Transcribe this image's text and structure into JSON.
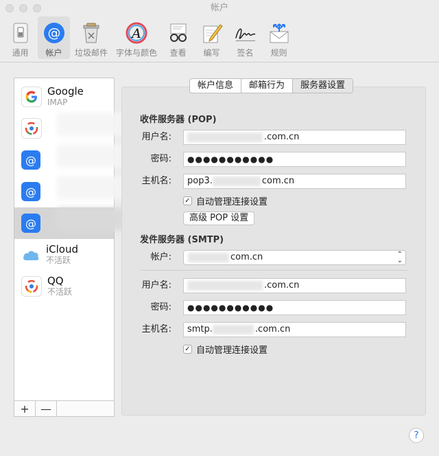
{
  "window": {
    "title": "帐户"
  },
  "toolbar": {
    "items": [
      {
        "label": "通用"
      },
      {
        "label": "帐户"
      },
      {
        "label": "垃圾邮件"
      },
      {
        "label": "字体与颜色"
      },
      {
        "label": "查看"
      },
      {
        "label": "编写"
      },
      {
        "label": "签名"
      },
      {
        "label": "规则"
      }
    ]
  },
  "accounts": [
    {
      "name": "Google",
      "sub": "IMAP"
    },
    {
      "name": "",
      "sub": ""
    },
    {
      "name": "",
      "sub": ""
    },
    {
      "name": "",
      "sub": ""
    },
    {
      "name": "",
      "sub": ""
    },
    {
      "name": "iCloud",
      "sub": "不活跃"
    },
    {
      "name": "QQ",
      "sub": "不活跃"
    }
  ],
  "list_footer": {
    "add": "+",
    "remove": "—"
  },
  "tabs": [
    {
      "label": "帐户信息"
    },
    {
      "label": "邮箱行为"
    },
    {
      "label": "服务器设置"
    }
  ],
  "incoming": {
    "title": "收件服务器 (POP)",
    "username_label": "用户名:",
    "username_value": ".com.cn",
    "password_label": "密码:",
    "password_value": "●●●●●●●●●●●",
    "host_label": "主机名:",
    "host_prefix": "pop3.",
    "host_suffix": "com.cn",
    "auto_manage": "自动管理连接设置",
    "advanced_button": "高级 POP 设置"
  },
  "outgoing": {
    "title": "发件服务器 (SMTP)",
    "account_label": "帐户:",
    "account_value": "com.cn",
    "username_label": "用户名:",
    "username_value": ".com.cn",
    "password_label": "密码:",
    "password_value": "●●●●●●●●●●●",
    "host_label": "主机名:",
    "host_prefix": "smtp.",
    "host_suffix": ".com.cn",
    "auto_manage": "自动管理连接设置"
  },
  "help": {
    "label": "?"
  },
  "colors": {
    "accent": "#2b7cf0",
    "selected_row": "#d5d5d5"
  }
}
